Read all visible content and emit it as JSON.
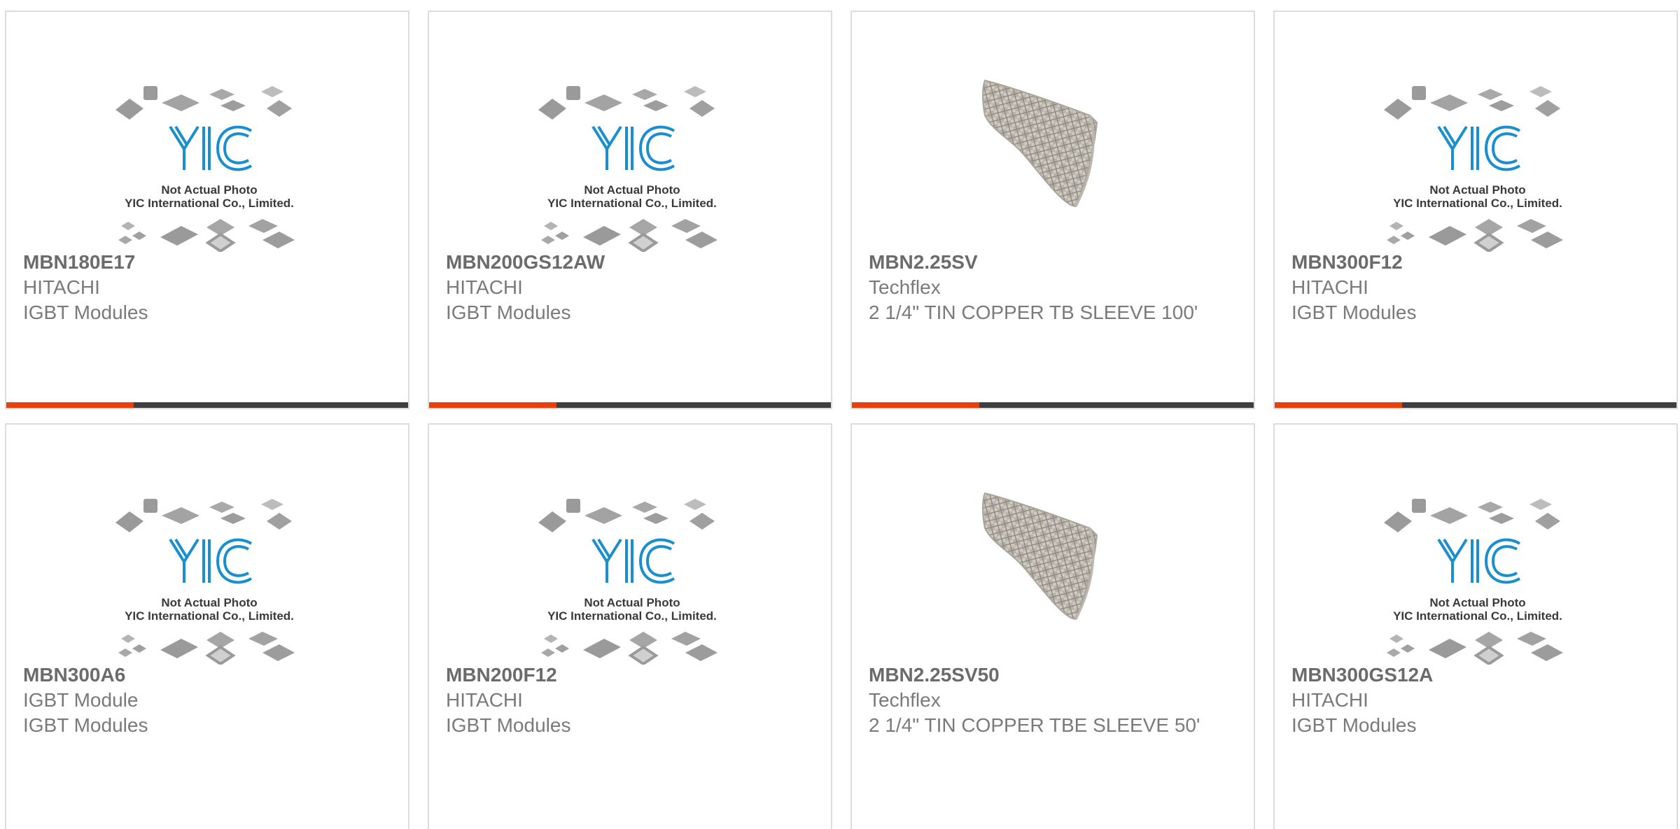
{
  "colors": {
    "accent": "#e8400c",
    "bar": "#3f3f3f",
    "logo": "#1a8fd0"
  },
  "placeholder": {
    "line1": "Not Actual Photo",
    "line2": "YIC International Co., Limited.",
    "logo_text": "YIC"
  },
  "products": [
    {
      "part": "MBN180E17",
      "maker": "HITACHI",
      "desc": "IGBT Modules",
      "image": "yic-placeholder"
    },
    {
      "part": "MBN200GS12AW",
      "maker": "HITACHI",
      "desc": "IGBT Modules",
      "image": "yic-placeholder"
    },
    {
      "part": "MBN2.25SV",
      "maker": "Techflex",
      "desc": "2 1/4\" TIN COPPER TB SLEEVE 100'",
      "image": "braided-sleeve"
    },
    {
      "part": "MBN300F12",
      "maker": "HITACHI",
      "desc": "IGBT Modules",
      "image": "yic-placeholder"
    },
    {
      "part": "MBN300A6",
      "maker": "IGBT Module",
      "desc": "IGBT Modules",
      "image": "yic-placeholder"
    },
    {
      "part": "MBN200F12",
      "maker": "HITACHI",
      "desc": "IGBT Modules",
      "image": "yic-placeholder"
    },
    {
      "part": "MBN2.25SV50",
      "maker": "Techflex",
      "desc": "2 1/4\" TIN COPPER TBE SLEEVE 50'",
      "image": "braided-sleeve"
    },
    {
      "part": "MBN300GS12A",
      "maker": "HITACHI",
      "desc": "IGBT Modules",
      "image": "yic-placeholder"
    }
  ]
}
